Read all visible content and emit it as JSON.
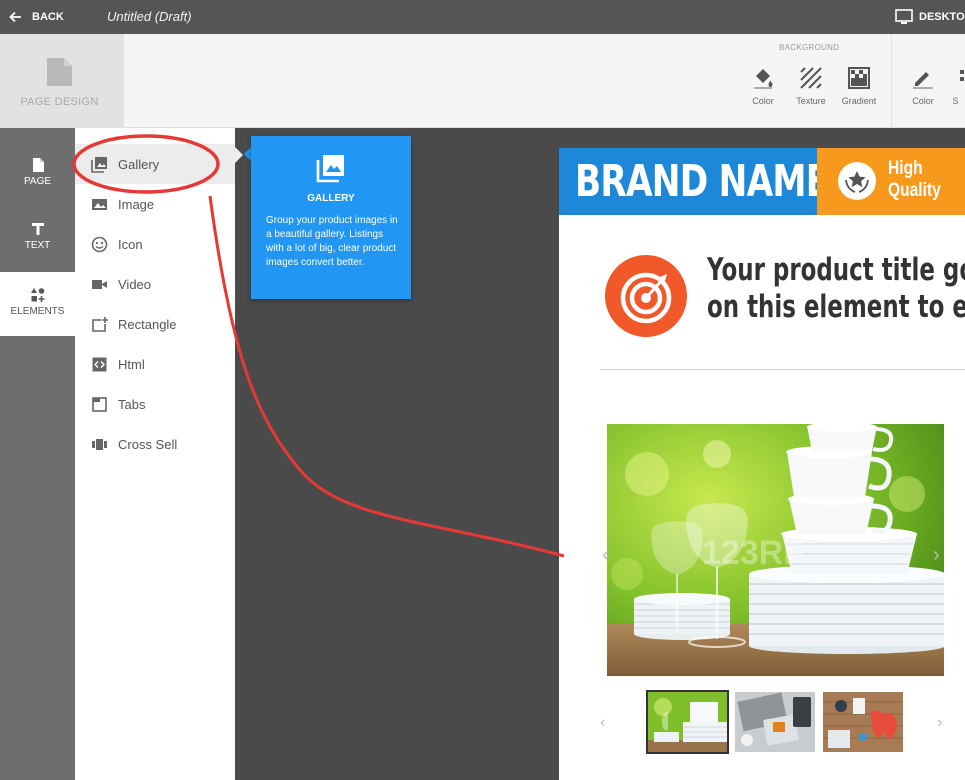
{
  "topbar": {
    "back_label": "BACK",
    "doc_title": "Untitled (Draft)",
    "device_label": "DESKTOP"
  },
  "toolbar": {
    "page_design_label": "PAGE DESIGN",
    "background_group_label": "BACKGROUND",
    "tools": [
      {
        "label": "Color",
        "icon": "paint-bucket-icon"
      },
      {
        "label": "Texture",
        "icon": "texture-icon"
      },
      {
        "label": "Gradient",
        "icon": "gradient-icon"
      },
      {
        "label": "Color",
        "icon": "pencil-icon"
      },
      {
        "label": "S",
        "icon": "more-icon"
      }
    ]
  },
  "rail": {
    "items": [
      {
        "label": "PAGE",
        "icon": "page-icon"
      },
      {
        "label": "TEXT",
        "icon": "text-icon"
      },
      {
        "label": "ELEMENTS",
        "icon": "shapes-icon"
      }
    ]
  },
  "elements": {
    "items": [
      {
        "label": "Gallery",
        "icon": "gallery-icon"
      },
      {
        "label": "Image",
        "icon": "image-icon"
      },
      {
        "label": "Icon",
        "icon": "smiley-icon"
      },
      {
        "label": "Video",
        "icon": "video-icon"
      },
      {
        "label": "Rectangle",
        "icon": "rectangle-add-icon"
      },
      {
        "label": "Html",
        "icon": "code-icon"
      },
      {
        "label": "Tabs",
        "icon": "tabs-icon"
      },
      {
        "label": "Cross Sell",
        "icon": "carousel-icon"
      }
    ]
  },
  "tooltip": {
    "title": "GALLERY",
    "description": "Group your product images in a beautiful gallery. Listings with a lot of big, clear product images convert better."
  },
  "canvas": {
    "brand_name": "BRAND NAME",
    "badge_line1": "High",
    "badge_line2": "Quality",
    "product_title_line1": "Your product title goes",
    "product_title_line2": "on this element to edit",
    "watermark": "123RF",
    "prev_arrow": "‹",
    "next_arrow": "›"
  },
  "colors": {
    "topbar": "#555555",
    "accent_blue": "#2196f3",
    "brand_blue": "#1e88d8",
    "badge_orange": "#f7991c",
    "target_orange": "#f1592a",
    "annotation_red": "#e53935"
  }
}
